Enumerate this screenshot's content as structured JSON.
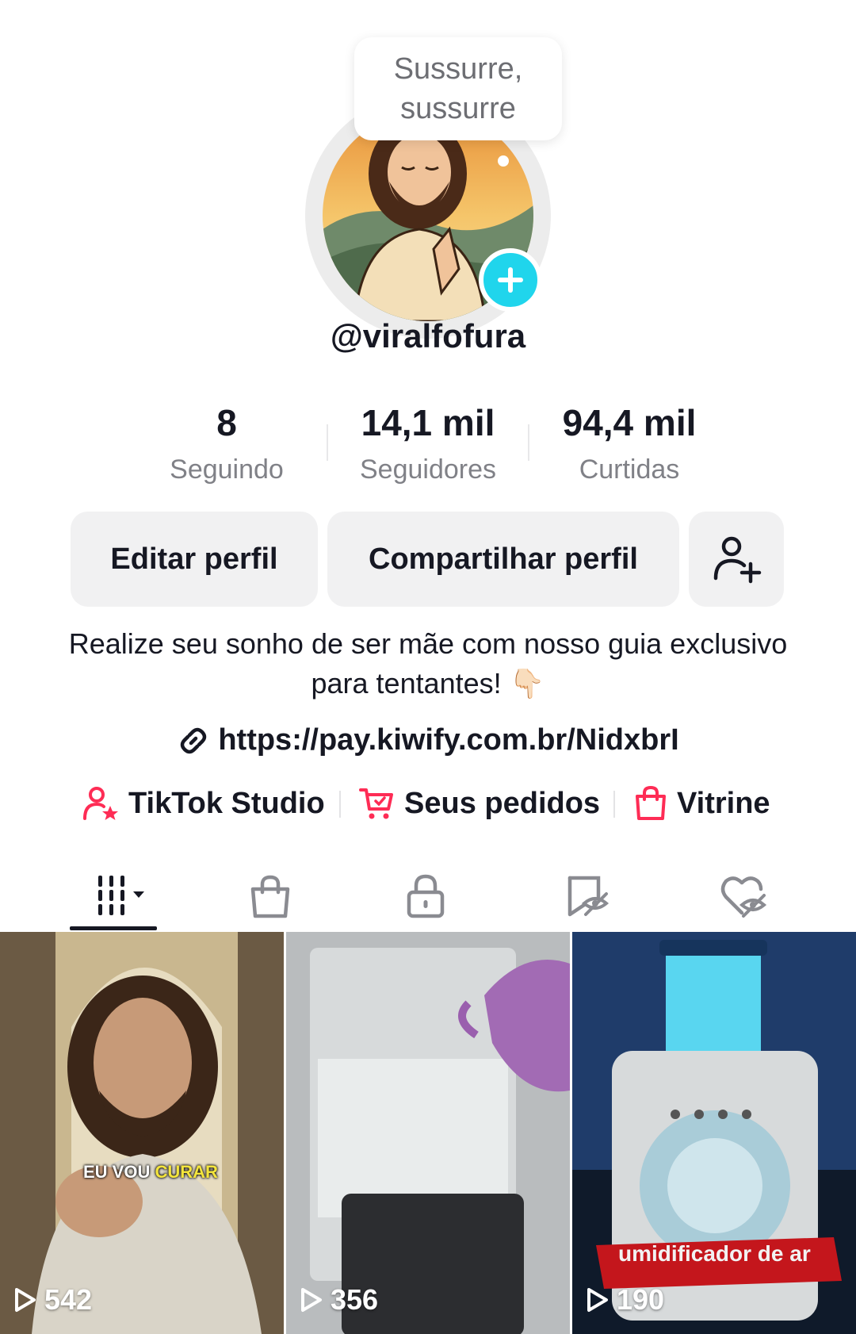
{
  "profile": {
    "bubble_text": "Sussurre,\nsussurre",
    "username": "@viralfofura"
  },
  "stats": {
    "following": {
      "value": "8",
      "label": "Seguindo"
    },
    "followers": {
      "value": "14,1 mil",
      "label": "Seguidores"
    },
    "likes": {
      "value": "94,4 mil",
      "label": "Curtidas"
    }
  },
  "actions": {
    "edit_label": "Editar perfil",
    "share_label": "Compartilhar perfil",
    "add_friend_icon": "person-add-icon"
  },
  "bio": {
    "text": "Realize seu sonho de ser mãe com nosso guia exclusivo para tentantes! 👇🏻",
    "link": "https://pay.kiwify.com.br/NidxbrI"
  },
  "shortcuts": {
    "studio_label": "TikTok Studio",
    "orders_label": "Seus pedidos",
    "showcase_label": "Vitrine"
  },
  "tabs": {
    "icons": [
      "grid-icon",
      "shopping-bag-icon",
      "lock-icon",
      "hidden-repost-icon",
      "hidden-liked-icon"
    ]
  },
  "videos": [
    {
      "views": "542",
      "caption_white": "EU VOU",
      "caption_yellow": "CURAR"
    },
    {
      "views": "356"
    },
    {
      "views": "190",
      "caption": "umidificador de ar"
    }
  ],
  "colors": {
    "accent_cyan": "#20d5ec",
    "accent_red": "#fe2c55",
    "text_primary": "#161823",
    "text_secondary": "#808187"
  }
}
